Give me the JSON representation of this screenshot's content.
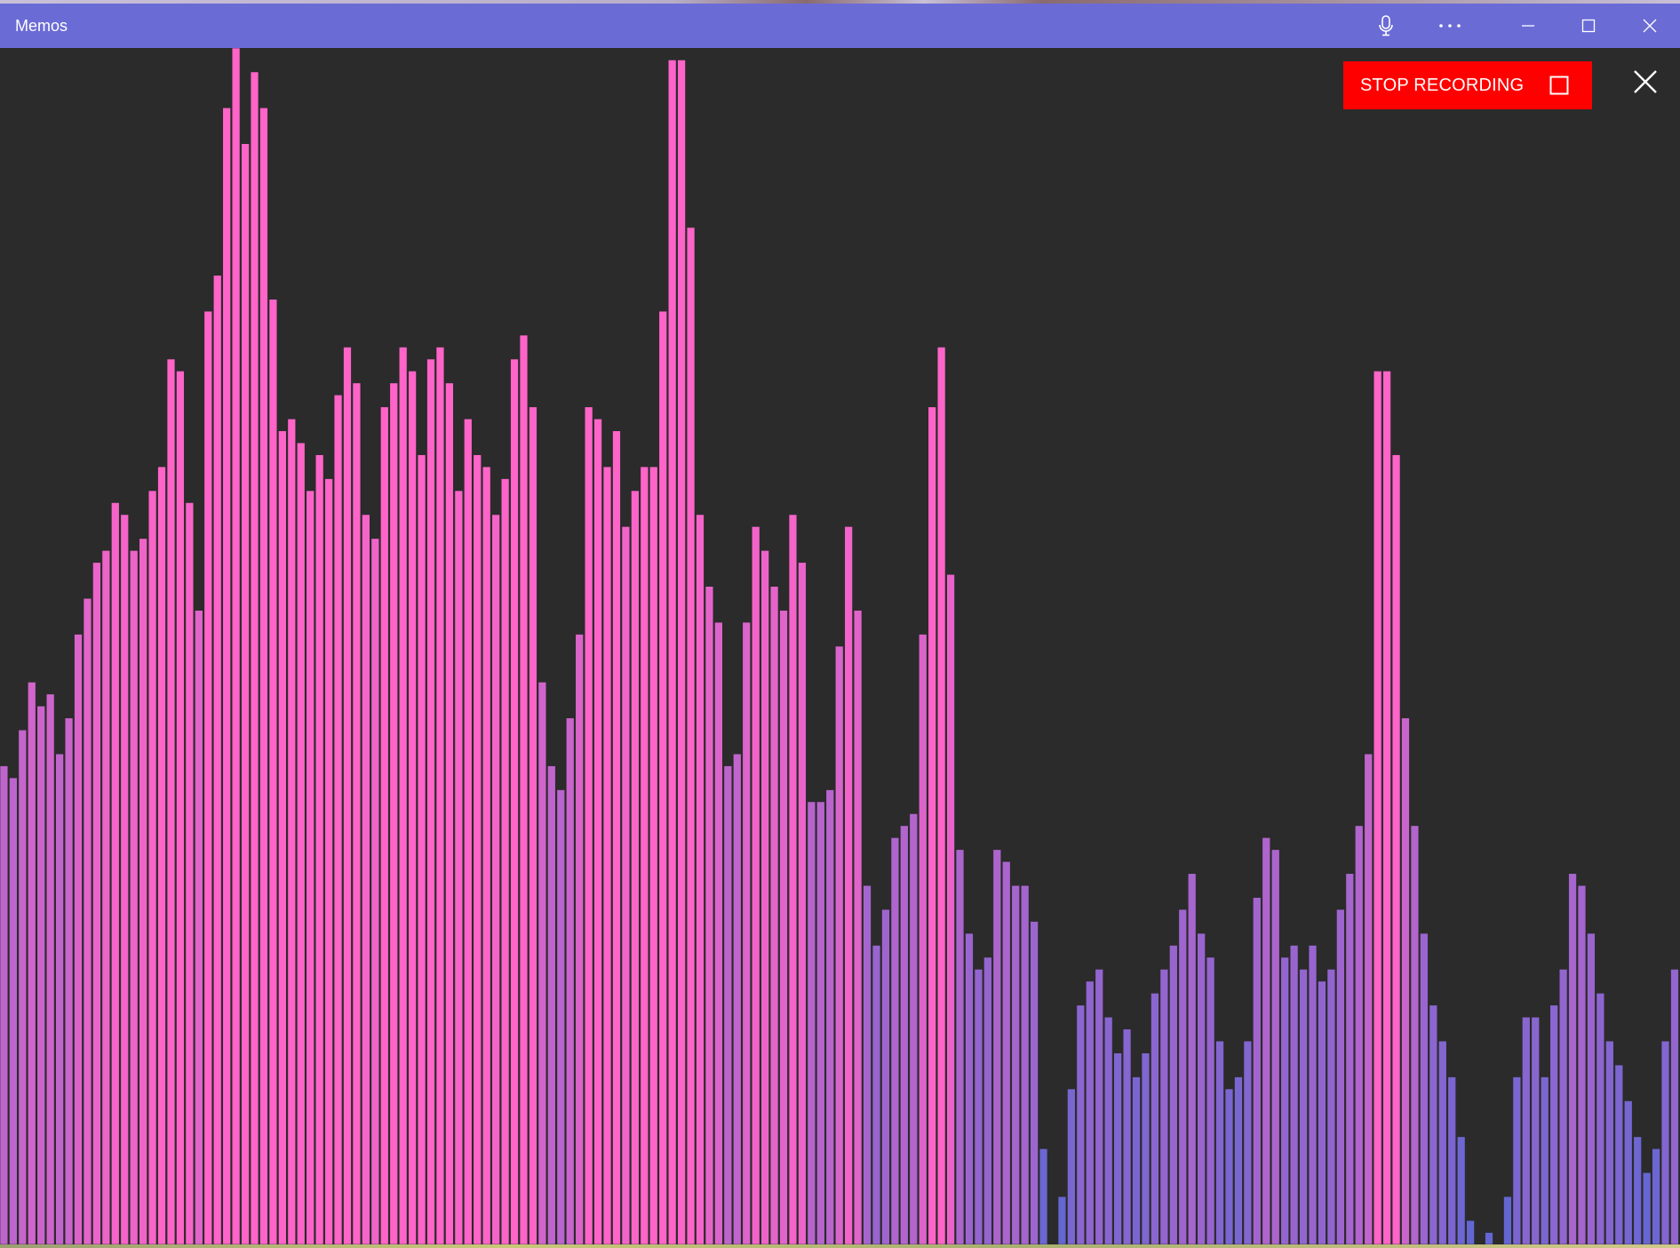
{
  "window": {
    "title": "Memos",
    "title_icons": [
      "microphone-icon",
      "more-icon",
      "minimize-icon",
      "maximize-icon",
      "close-icon"
    ]
  },
  "recording": {
    "stop_label": "STOP RECORDING",
    "stop_icon": "stop-square-icon",
    "close_icon": "close-icon"
  },
  "colors": {
    "titlebar": "#6b6bd6",
    "background": "#2b2b2b",
    "stop_button": "#ff0000",
    "bar_high": "#ff64c8",
    "bar_low": "#6466d2"
  },
  "chart_data": {
    "type": "bar",
    "ylim": [
      0,
      1
    ],
    "values": [
      0.4,
      0.39,
      0.43,
      0.47,
      0.45,
      0.46,
      0.41,
      0.44,
      0.51,
      0.54,
      0.57,
      0.58,
      0.62,
      0.61,
      0.58,
      0.59,
      0.63,
      0.65,
      0.74,
      0.73,
      0.62,
      0.53,
      0.78,
      0.81,
      0.95,
      1.0,
      0.92,
      0.98,
      0.95,
      0.79,
      0.68,
      0.69,
      0.67,
      0.63,
      0.66,
      0.64,
      0.71,
      0.75,
      0.72,
      0.61,
      0.59,
      0.7,
      0.72,
      0.75,
      0.73,
      0.66,
      0.74,
      0.75,
      0.72,
      0.63,
      0.69,
      0.66,
      0.65,
      0.61,
      0.64,
      0.74,
      0.76,
      0.7,
      0.47,
      0.4,
      0.38,
      0.44,
      0.51,
      0.7,
      0.69,
      0.65,
      0.68,
      0.6,
      0.63,
      0.65,
      0.65,
      0.78,
      0.99,
      0.99,
      0.85,
      0.61,
      0.55,
      0.52,
      0.4,
      0.41,
      0.52,
      0.6,
      0.58,
      0.55,
      0.53,
      0.61,
      0.57,
      0.37,
      0.37,
      0.38,
      0.5,
      0.6,
      0.53,
      0.3,
      0.25,
      0.28,
      0.34,
      0.35,
      0.36,
      0.51,
      0.7,
      0.75,
      0.56,
      0.33,
      0.26,
      0.23,
      0.24,
      0.33,
      0.32,
      0.3,
      0.3,
      0.27,
      0.08,
      0.0,
      0.04,
      0.13,
      0.2,
      0.22,
      0.23,
      0.19,
      0.16,
      0.18,
      0.14,
      0.16,
      0.21,
      0.23,
      0.25,
      0.28,
      0.31,
      0.26,
      0.24,
      0.17,
      0.13,
      0.14,
      0.17,
      0.29,
      0.34,
      0.33,
      0.24,
      0.25,
      0.23,
      0.25,
      0.22,
      0.23,
      0.28,
      0.31,
      0.35,
      0.41,
      0.73,
      0.73,
      0.66,
      0.44,
      0.35,
      0.26,
      0.2,
      0.17,
      0.14,
      0.09,
      0.02,
      0.0,
      0.01,
      0.0,
      0.04,
      0.14,
      0.19,
      0.19,
      0.14,
      0.2,
      0.23,
      0.31,
      0.3,
      0.26,
      0.21,
      0.17,
      0.15,
      0.12,
      0.09,
      0.06,
      0.08,
      0.17,
      0.23
    ]
  }
}
